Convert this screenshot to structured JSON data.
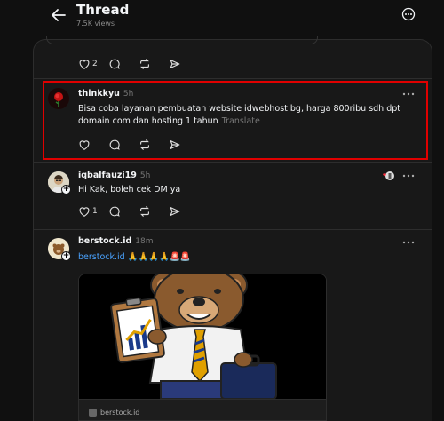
{
  "header": {
    "title": "Thread",
    "views": "7.5K views"
  },
  "top_post": {
    "likes": "2"
  },
  "posts": [
    {
      "username": "thinkkyu",
      "time": "5h",
      "text": "Bisa coba layanan pembuatan website idwebhost bg, harga 800ribu sdh dpt domain com dan hosting 1 tahun",
      "translate": "Translate"
    },
    {
      "username": "iqbalfauzi19",
      "time": "5h",
      "text": "Hi Kak, boleh cek DM ya",
      "likes": "1"
    },
    {
      "username": "berstock.id",
      "time": "18m",
      "link": "berstock.id",
      "emojis": "🙏🙏🙏🙏🚨🚨",
      "media_domain": "berstock.id"
    }
  ],
  "colors": {
    "highlight": "#e00000",
    "link": "#4aa3ff",
    "background": "#101010"
  }
}
